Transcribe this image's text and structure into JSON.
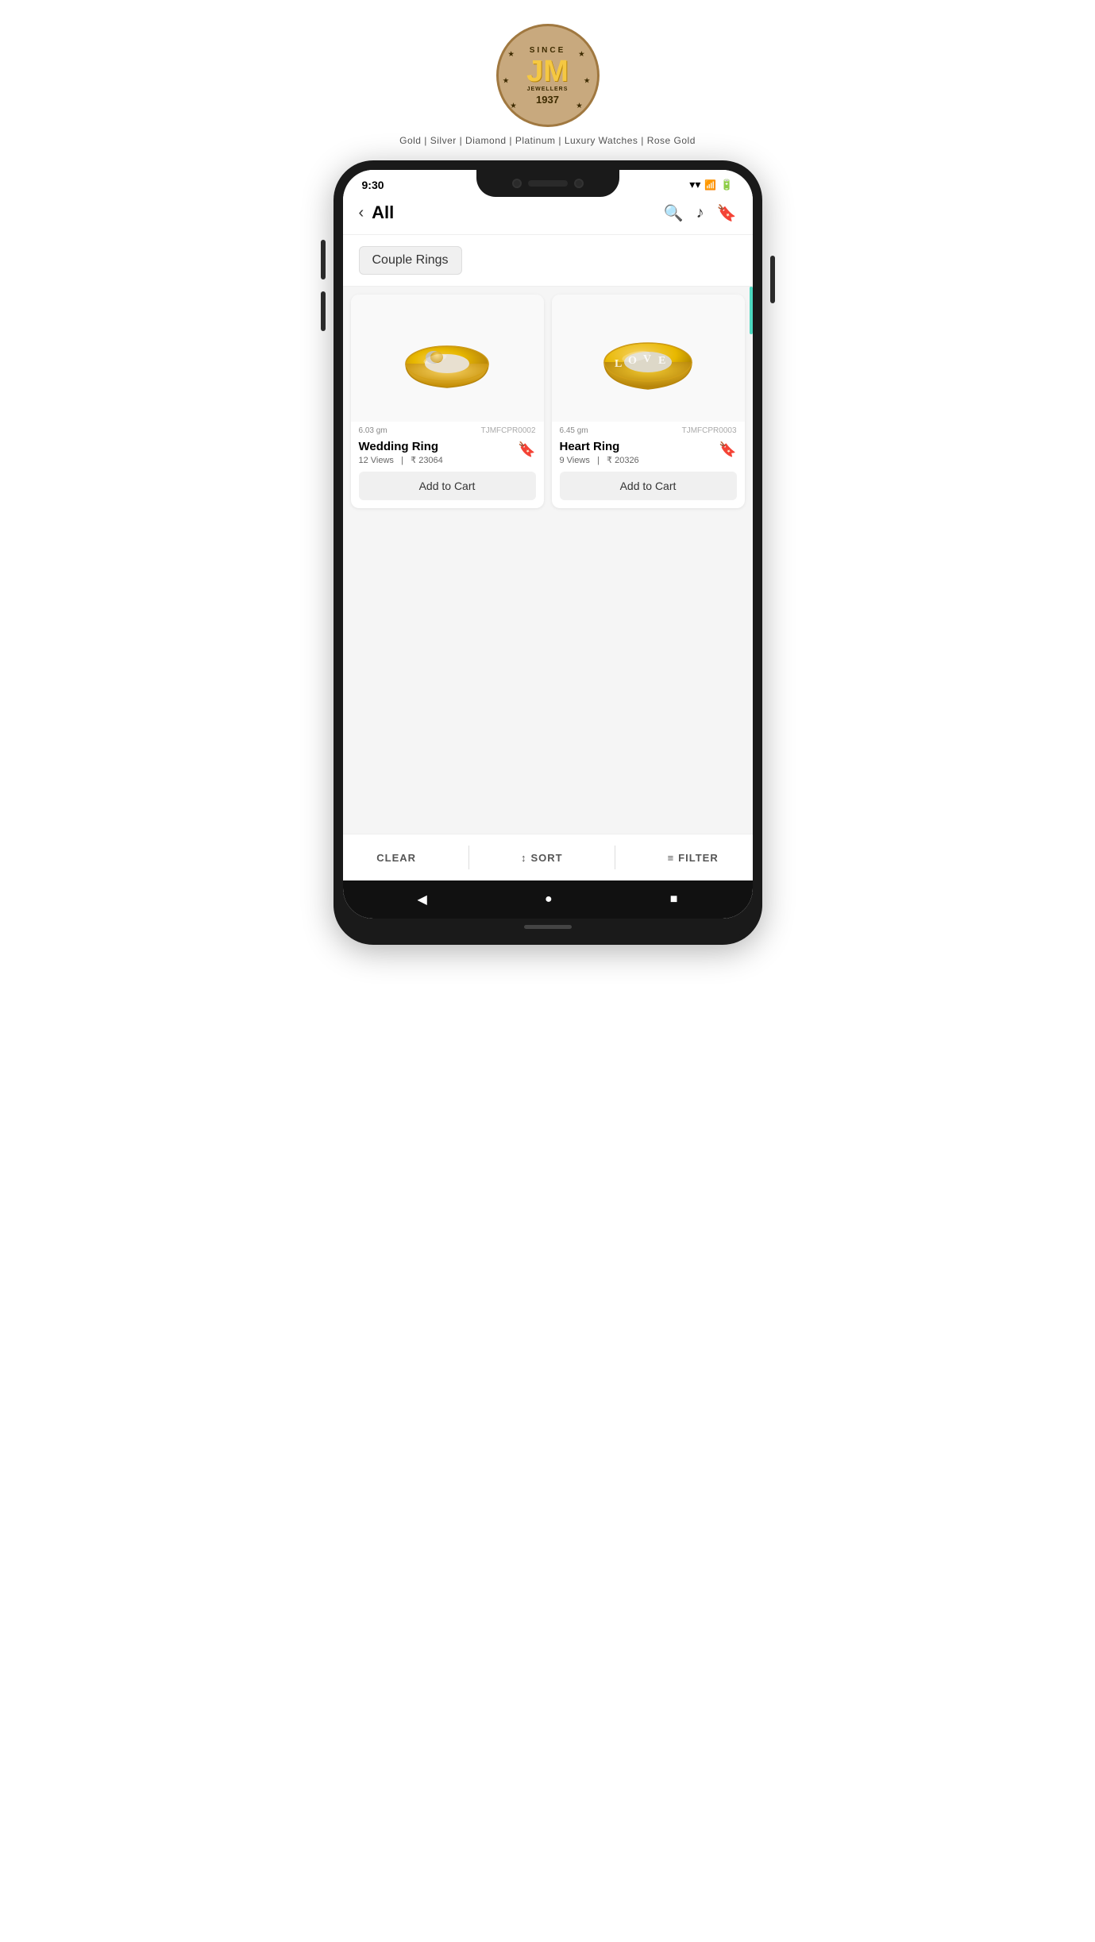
{
  "logo": {
    "since": "SINCE",
    "brand": "JM",
    "sub": "JEWELLERS",
    "year": "1937"
  },
  "tagline": "Gold  |  Silver  |  Diamond  |  Platinum  |  Luxury Watches  |  Rose Gold",
  "status": {
    "time": "9:30"
  },
  "header": {
    "title": "All",
    "back_label": "‹"
  },
  "filter": {
    "tag_label": "Couple Rings"
  },
  "products": [
    {
      "name": "Wedding Ring",
      "views": "12 Views",
      "price": "₹ 23064",
      "weight": "6.03 gm",
      "code": "TJMFCPR0002",
      "add_to_cart": "Add to Cart"
    },
    {
      "name": "Heart Ring",
      "views": "9 Views",
      "price": "₹ 20326",
      "weight": "6.45 gm",
      "code": "TJMFCPR0003",
      "add_to_cart": "Add to Cart"
    }
  ],
  "bottom_bar": {
    "clear_label": "CLEAR",
    "sort_label": "SORT",
    "filter_label": "FILTER"
  },
  "nav": {
    "back": "◀",
    "home": "●",
    "recent": "■"
  }
}
